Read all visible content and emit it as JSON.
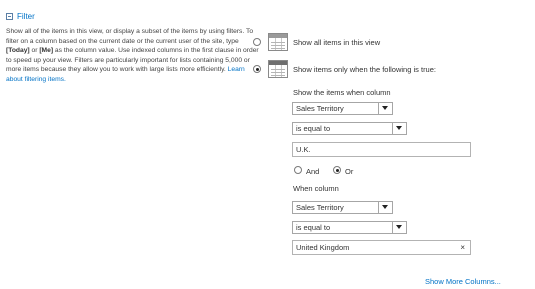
{
  "section": {
    "title": "Filter",
    "description_parts": [
      "Show all of the items in this view, or display a subset of the items by using filters. To filter on a column based on the current date or the current user of the site, type ",
      "[Today]",
      " or ",
      "[Me]",
      " as the column value. Use indexed columns in the first clause in order to speed up your view. Filters are particularly important for lists containing 5,000 or more items because they allow you to work with large lists more efficiently. "
    ],
    "learn_link": "Learn about filtering items."
  },
  "options": {
    "show_all": "Show all items in this view",
    "show_filtered": "Show items only when the following is true:"
  },
  "filter1": {
    "label": "Show the items when column",
    "column": "Sales Territory",
    "operator": "is equal to",
    "value": "U.K."
  },
  "logic": {
    "and": "And",
    "or": "Or",
    "selected": "Or"
  },
  "filter2": {
    "label": "When column",
    "column": "Sales Territory",
    "operator": "is equal to",
    "value": "United Kingdom",
    "clear_glyph": "×"
  },
  "more_columns": "Show More Columns..."
}
